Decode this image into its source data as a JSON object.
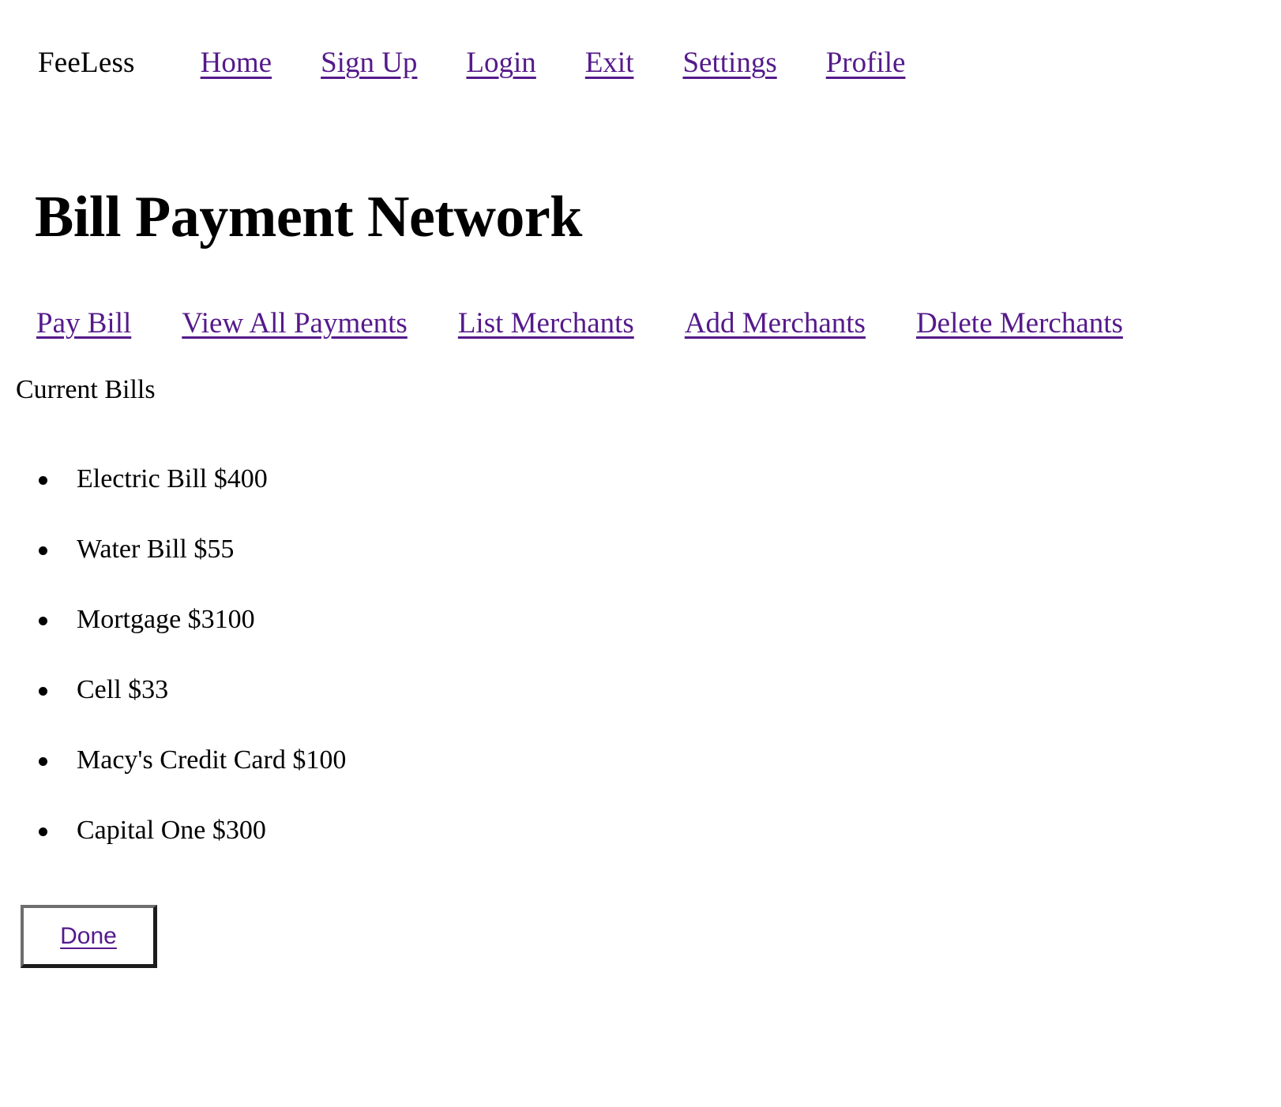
{
  "colors": {
    "link": "#551a8b",
    "text": "#000000",
    "background": "#ffffff",
    "button_border_light": "#6e6e6e",
    "button_border_dark": "#1c1c1c"
  },
  "topnav": {
    "brand": "FeeLess",
    "links": [
      {
        "label": "Home"
      },
      {
        "label": "Sign Up"
      },
      {
        "label": "Login"
      },
      {
        "label": "Exit"
      },
      {
        "label": "Settings"
      },
      {
        "label": "Profile"
      }
    ]
  },
  "page": {
    "title": "Bill Payment Network"
  },
  "sectionnav": {
    "links": [
      {
        "label": "Pay Bill"
      },
      {
        "label": "View All Payments"
      },
      {
        "label": "List Merchants"
      },
      {
        "label": "Add Merchants"
      },
      {
        "label": "Delete Merchants"
      }
    ]
  },
  "bills": {
    "heading": "Current Bills",
    "bullet_glyph": "•",
    "items": [
      {
        "label": "Electric Bill $400"
      },
      {
        "label": "Water Bill $55"
      },
      {
        "label": "Mortgage $3100"
      },
      {
        "label": "Cell $33"
      },
      {
        "label": "Macy's Credit Card $100"
      },
      {
        "label": "Capital One $300"
      }
    ]
  },
  "actions": {
    "done_label": "Done"
  }
}
